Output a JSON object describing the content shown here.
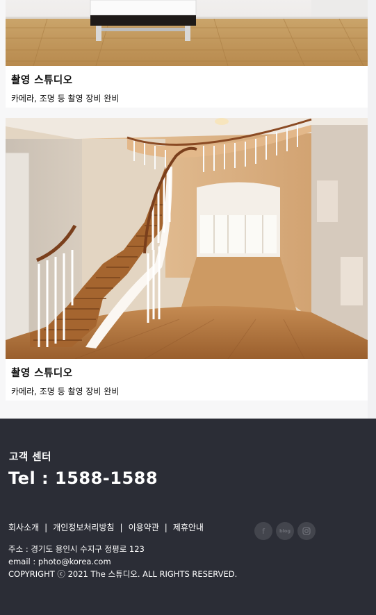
{
  "cards": [
    {
      "title": "촬영 스튜디오",
      "desc": "카메라, 조명 등 촬영 장비 완비",
      "image": "white-sofa-on-wood-floor"
    },
    {
      "title": "촬영 스튜디오",
      "desc": "카메라, 조명 등 촬영 장비 완비",
      "image": "curved-staircase-hall"
    }
  ],
  "footer": {
    "cs_title": "고객 센터",
    "tel": "Tel : 1588-1588",
    "links": [
      "회사소개",
      "개인정보처리방침",
      "이용약관",
      "제휴안내"
    ],
    "separator": "|",
    "social": [
      {
        "icon": "facebook-icon",
        "label": "f"
      },
      {
        "icon": "blog-icon",
        "label": "blog"
      },
      {
        "icon": "instagram-icon",
        "label": ""
      }
    ],
    "address": "주소 : 경기도 용인시 수지구 정평로 123",
    "email": "email : photo@korea.com",
    "copyright": "COPYRIGHT ⓒ 2021 The 스튜디오. ALL RIGHTS RESERVED."
  },
  "colors": {
    "footer_bg": "#2b2d36",
    "page_bg": "#f7f7f8",
    "social_bg": "#43454d"
  }
}
